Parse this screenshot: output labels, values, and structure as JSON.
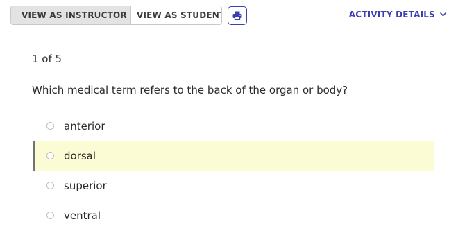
{
  "toolbar": {
    "view_as_instructor": "VIEW AS INSTRUCTOR",
    "view_as_student": "VIEW AS STUDENT",
    "activity_details": "ACTIVITY DETAILS",
    "icons": {
      "active_view": "check-circle-icon",
      "print": "printer-icon",
      "details": "chevron-down-icon"
    }
  },
  "question": {
    "counter": "1 of 5",
    "text": "Which medical term refers to the back of the organ or body?",
    "options": [
      {
        "label": "anterior",
        "highlighted": false
      },
      {
        "label": "dorsal",
        "highlighted": true
      },
      {
        "label": "superior",
        "highlighted": false
      },
      {
        "label": "ventral",
        "highlighted": false
      }
    ]
  },
  "colors": {
    "accent": "#3b3fb0",
    "highlight_background": "#fbfbd4",
    "active_toggle_background": "#e3e3e3",
    "text": "#2b2b2b"
  }
}
